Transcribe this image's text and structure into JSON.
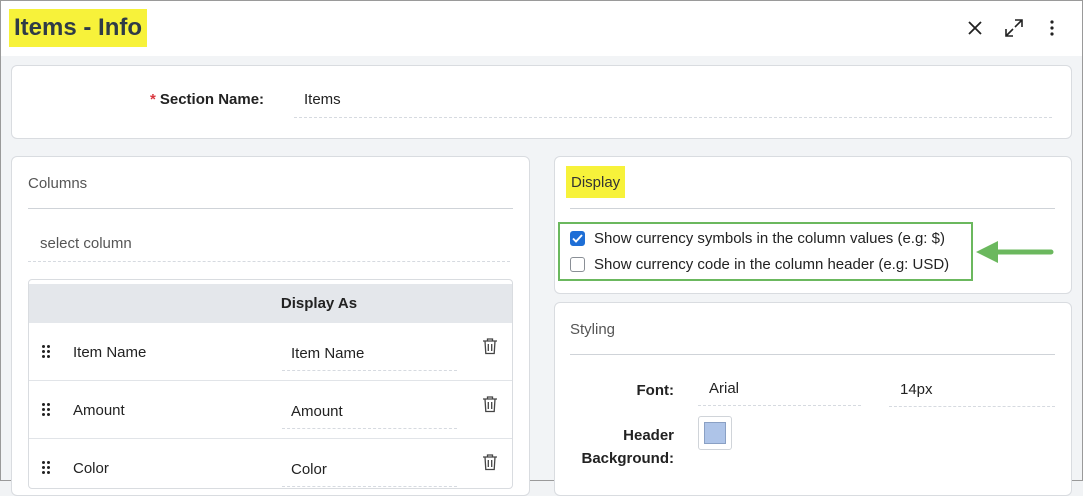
{
  "header": {
    "title": "Items - Info"
  },
  "section": {
    "required_mark": "*",
    "label": "Section Name:",
    "value": "Items"
  },
  "columns_panel": {
    "title": "Columns",
    "select_placeholder": "select column",
    "table_header": "Display As",
    "rows": [
      {
        "name": "Item Name",
        "display": "Item Name"
      },
      {
        "name": "Amount",
        "display": "Amount"
      },
      {
        "name": "Color",
        "display": "Color"
      }
    ]
  },
  "display_panel": {
    "title": "Display",
    "options": [
      {
        "label": "Show currency symbols in the column values (e.g: $)",
        "checked": true
      },
      {
        "label": "Show currency code in the column header (e.g: USD)",
        "checked": false
      }
    ]
  },
  "styling_panel": {
    "title": "Styling",
    "font_label": "Font:",
    "font_family": "Arial",
    "font_size": "14px",
    "header_bg_label_1": "Header",
    "header_bg_label_2": "Background:",
    "header_bg_color": "#aec4e8"
  },
  "colors": {
    "highlight": "#f7f23a",
    "annotation_green": "#6bb85e",
    "checkbox_blue": "#1f6fd6"
  }
}
